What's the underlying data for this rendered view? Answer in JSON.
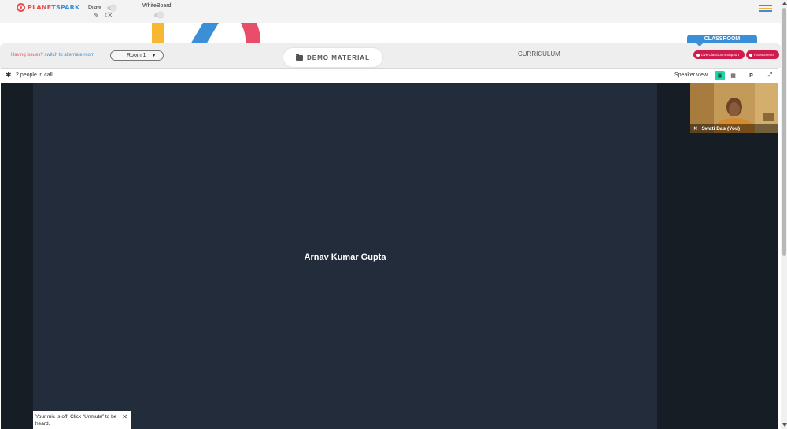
{
  "brand": {
    "name_part1": "PLANET",
    "name_part2": "SPARK"
  },
  "toolbar": {
    "draw_label": "Draw",
    "whiteboard_label": "WhiteBoard",
    "pencil_icon": "pencil-icon",
    "eraser_icon": "eraser-icon"
  },
  "room_bar": {
    "issues_text": "Having issues?",
    "switch_link": "switch to alternate room",
    "room_selected": "Room 1",
    "demo_material": "DEMO MATERIAL",
    "curriculum": "CURRICULUM",
    "classroom_tab": "CLASSROOM",
    "live_support": "Live Classroom Support",
    "ps_moments": "PS Moments"
  },
  "call": {
    "people_count": "2 people in call",
    "view_mode": "Speaker view",
    "pin_label": "P",
    "main_participant": "Arnav Kumar Gupta",
    "self_name": "Swati Das (You)"
  },
  "toast": {
    "message": "Your mic is off. Click “Unmute” to be heard.",
    "close": "✕"
  },
  "colors": {
    "accent_red": "#cf1c4d",
    "accent_blue": "#3a8fd6",
    "speaker_active": "#21d6a5",
    "stage_bg": "#161d24",
    "tile_bg": "#222c3a"
  }
}
